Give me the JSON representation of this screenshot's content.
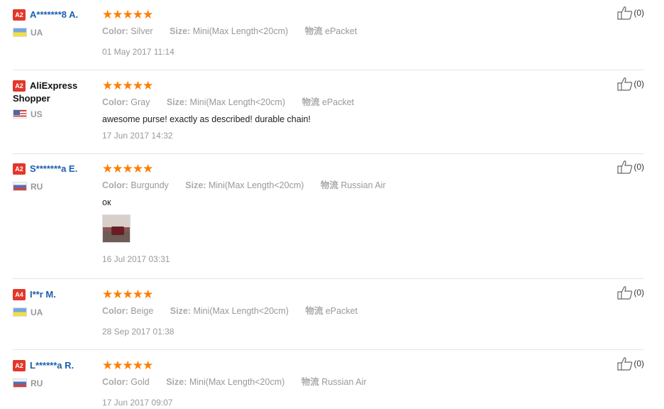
{
  "labels": {
    "color": "Color:",
    "size": "Size:",
    "shipping": "物流"
  },
  "reviews": [
    {
      "level": "A2",
      "name": "A*******8 A.",
      "name2": "",
      "country": "UA",
      "stars": "★★★★★",
      "color": "Silver",
      "size": "Mini(Max Length<20cm)",
      "shipping": "ePacket",
      "text": "",
      "has_photo": false,
      "date": "01 May 2017 11:14",
      "likes": "(0)"
    },
    {
      "level": "A2",
      "name": "AliExpress",
      "name2": "Shopper",
      "country": "US",
      "stars": "★★★★★",
      "color": "Gray",
      "size": "Mini(Max Length<20cm)",
      "shipping": "ePacket",
      "text": "awesome purse! exactly as described! durable chain!",
      "has_photo": false,
      "date": "17 Jun 2017 14:32",
      "likes": "(0)"
    },
    {
      "level": "A2",
      "name": "S*******a E.",
      "name2": "",
      "country": "RU",
      "stars": "★★★★★",
      "color": "Burgundy",
      "size": "Mini(Max Length<20cm)",
      "shipping": "Russian Air",
      "text": "ок",
      "has_photo": true,
      "date": "16 Jul 2017 03:31",
      "likes": "(0)"
    },
    {
      "level": "A4",
      "name": "I**r M.",
      "name2": "",
      "country": "UA",
      "stars": "★★★★★",
      "color": "Beige",
      "size": "Mini(Max Length<20cm)",
      "shipping": "ePacket",
      "text": "",
      "has_photo": false,
      "date": "28 Sep 2017 01:38",
      "likes": "(0)"
    },
    {
      "level": "A2",
      "name": "L******a R.",
      "name2": "",
      "country": "RU",
      "stars": "★★★★★",
      "color": "Gold",
      "size": "Mini(Max Length<20cm)",
      "shipping": "Russian Air",
      "text": "",
      "has_photo": false,
      "date": "17 Jun 2017 09:07",
      "likes": "(0)"
    }
  ]
}
